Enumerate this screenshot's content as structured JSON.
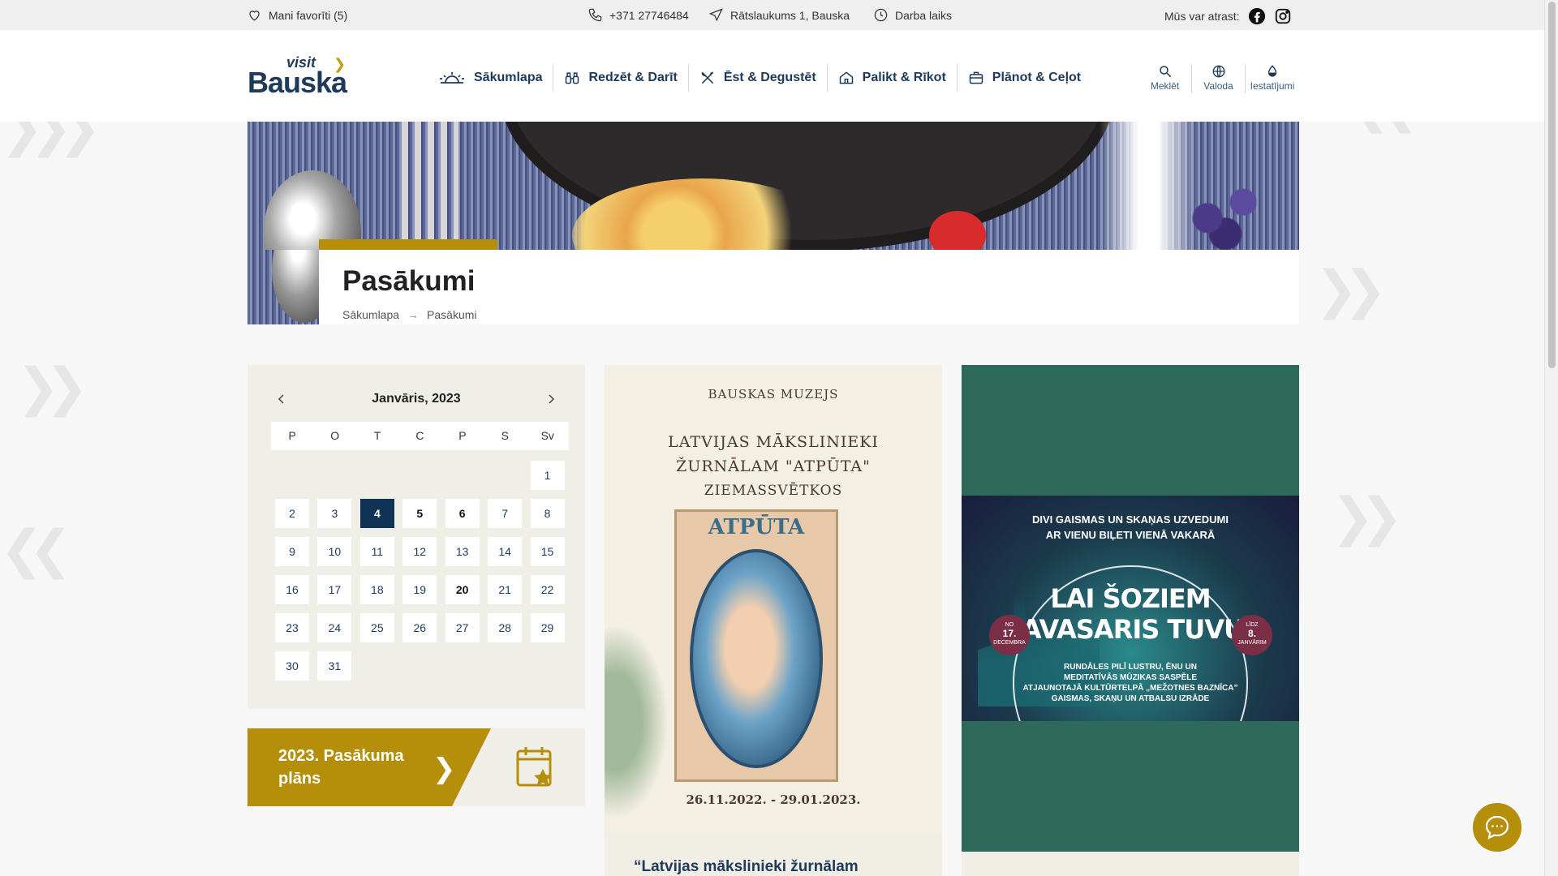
{
  "topbar": {
    "favorites": "Mani favorīti (5)",
    "phone": "+371 27746484",
    "address": "Rātslaukums 1, Bauska",
    "hours": "Darba laiks",
    "find_us": "Mūs var atrast:"
  },
  "logo": {
    "visit": "visit",
    "name": "Bauska"
  },
  "nav": {
    "items": [
      {
        "label": "Sākumlapa",
        "icon": "sunrise-icon"
      },
      {
        "label": "Redzēt & Darīt",
        "icon": "binoculars-icon"
      },
      {
        "label": "Ēst & Degustēt",
        "icon": "cutlery-icon"
      },
      {
        "label": "Palikt & Rīkot",
        "icon": "house-icon"
      },
      {
        "label": "Plānot & Ceļot",
        "icon": "suitcase-icon"
      }
    ]
  },
  "tools": {
    "search": "Meklēt",
    "language": "Valoda",
    "settings": "Iestatījumi"
  },
  "page": {
    "title": "Pasākumi",
    "breadcrumb": [
      "Sākumlapa",
      "Pasākumi"
    ]
  },
  "calendar": {
    "month": "Janvāris, 2023",
    "weekdays": [
      "P",
      "O",
      "T",
      "C",
      "P",
      "S",
      "Sv"
    ],
    "leading_blanks": 6,
    "days": [
      1,
      2,
      3,
      4,
      5,
      6,
      7,
      8,
      9,
      10,
      11,
      12,
      13,
      14,
      15,
      16,
      17,
      18,
      19,
      20,
      21,
      22,
      23,
      24,
      25,
      26,
      27,
      28,
      29,
      30,
      31
    ],
    "selected": 4,
    "bold_days": [
      5,
      6,
      20
    ]
  },
  "plan": {
    "label": "2023. Pasākuma plāns"
  },
  "events": [
    {
      "museum": "BAUSKAS MUZEJS",
      "title_lines": [
        "LATVIJAS MĀKSLINIEKI",
        "ŽURNĀLAM \"ATPŪTA\"",
        "ZIEMASSVĒTKOS"
      ],
      "magazine": "ATPŪTA",
      "dates": "26.11.2022. - 29.01.2023.",
      "card_title": "“Latvijas mākslinieki žurnālam"
    },
    {
      "top_lines": [
        "DIVI GAISMAS UN SKAŅAS UZVEDUMI",
        "AR VIENU BIĻETI VIENĀ VAKARĀ"
      ],
      "big_lines": [
        "LAI ŠOZIEM",
        "PAVASARIS TUVU!"
      ],
      "small_lines": [
        "RUNDĀLES PILĪ LUSTRU, ĒNU UN",
        "MEDITATĪVĀS MŪZIKAS SASPĒLE",
        "ATJAUNOTAJĀ KULTŪRTELPĀ „MEŽOTNES BAZNĪCA”",
        "GAISMAS, SKAŅU UN ATBALSU IZRĀDE"
      ],
      "from": {
        "pre": "NO",
        "num": "17.",
        "post": "DECEMBRA"
      },
      "to": {
        "pre": "LĪDZ",
        "num": "8.",
        "post": "JANVĀRIM"
      }
    }
  ],
  "colors": {
    "navy": "#1d3a5a",
    "gold": "#b58e0a",
    "selected_day": "#0f3357",
    "event_green": "#2d6a5a"
  }
}
